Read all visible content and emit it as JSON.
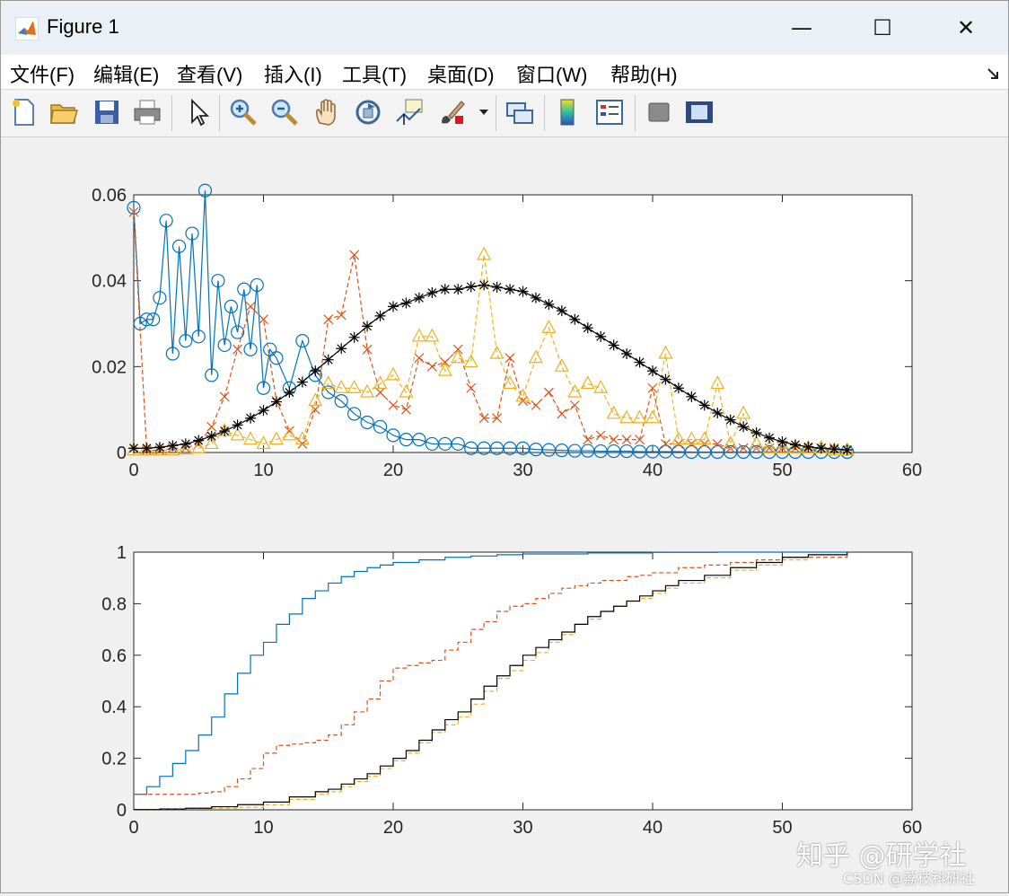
{
  "window": {
    "title": "Figure 1",
    "minimize_glyph": "—",
    "maximize_glyph": "☐",
    "close_glyph": "✕"
  },
  "menu": [
    {
      "label": "文件(F)"
    },
    {
      "label": "编辑(E)"
    },
    {
      "label": "查看(V)"
    },
    {
      "label": "插入(I)"
    },
    {
      "label": "工具(T)"
    },
    {
      "label": "桌面(D)"
    },
    {
      "label": "窗口(W)"
    },
    {
      "label": "帮助(H)"
    }
  ],
  "toolbar_icons": [
    "new-figure-icon",
    "open-file-icon",
    "save-icon",
    "print-icon",
    "select-arrow-icon",
    "zoom-in-icon",
    "zoom-out-icon",
    "pan-hand-icon",
    "rotate-3d-icon",
    "data-cursor-icon",
    "brush-icon",
    "link-plot-icon",
    "colorbar-icon",
    "legend-icon",
    "hide-plot-tools-icon",
    "show-plot-tools-icon"
  ],
  "colors": {
    "blue": "#0072bd",
    "orange": "#d95319",
    "yellow": "#edb120",
    "black": "#000000"
  },
  "watermark": {
    "line1": "知乎 @研学社",
    "line2": "CSDN @荔枝科研社"
  },
  "chart_data": [
    {
      "type": "line",
      "xlim": [
        0,
        60
      ],
      "ylim": [
        0,
        0.06
      ],
      "xticks": [
        0,
        10,
        20,
        30,
        40,
        50,
        60
      ],
      "yticks": [
        0,
        0.02,
        0.04,
        0.06
      ],
      "grid": false,
      "series": [
        {
          "color": "blue",
          "marker": "circle",
          "dash": "solid",
          "x": [
            0,
            1,
            2,
            3,
            4,
            5,
            6,
            7,
            8,
            9,
            10,
            11,
            12,
            13,
            14,
            15,
            16,
            17,
            18,
            19,
            20,
            21,
            22,
            23,
            24,
            25,
            26,
            27,
            28,
            29,
            30,
            31,
            32,
            33,
            34,
            35,
            36,
            37,
            38,
            39,
            40,
            41,
            42,
            43,
            44,
            45,
            46,
            47,
            48,
            49,
            50,
            51,
            52,
            53,
            54,
            55
          ],
          "y": [
            0.057,
            0.031,
            0.036,
            0.023,
            0.026,
            0.027,
            0.018,
            0.025,
            0.028,
            0.024,
            0.015,
            0.022,
            0.015,
            0.026,
            0.018,
            0.014,
            0.012,
            0.009,
            0.007,
            0.006,
            0.004,
            0.003,
            0.003,
            0.002,
            0.002,
            0.002,
            0.001,
            0.001,
            0.001,
            0.001,
            0.001,
            0.0007,
            0.0006,
            0.0005,
            0.0004,
            0.0004,
            0.0003,
            0.0003,
            0.0003,
            0.0002,
            0.0002,
            0.0002,
            0.0002,
            0.0001,
            0.0001,
            0.0001,
            0.0001,
            0.0001,
            0.0001,
            0.0001,
            0.0001,
            0.0001,
            0.0001,
            0.0001,
            0.0001,
            0.0001
          ],
          "x_extra": [
            1,
            2,
            3,
            4,
            5,
            6,
            7,
            8,
            9,
            10,
            11
          ],
          "y_extra": [
            0.03,
            0.031,
            0.054,
            0.048,
            0.051,
            0.061,
            0.04,
            0.034,
            0.038,
            0.039,
            0.024
          ]
        },
        {
          "color": "orange",
          "marker": "x",
          "dash": "dashed",
          "x": [
            0,
            1,
            2,
            3,
            4,
            5,
            6,
            7,
            8,
            9,
            10,
            11,
            12,
            13,
            14,
            15,
            16,
            17,
            18,
            19,
            20,
            21,
            22,
            23,
            24,
            25,
            26,
            27,
            28,
            29,
            30,
            31,
            32,
            33,
            34,
            35,
            36,
            37,
            38,
            39,
            40,
            41,
            42,
            43,
            44,
            45,
            46,
            47,
            48,
            49,
            50,
            51,
            52,
            53,
            54,
            55
          ],
          "y": [
            0.056,
            0.0005,
            0.0005,
            0.001,
            0.001,
            0.002,
            0.006,
            0.013,
            0.024,
            0.034,
            0.031,
            0.012,
            0.005,
            0.002,
            0.01,
            0.031,
            0.032,
            0.046,
            0.024,
            0.014,
            0.011,
            0.01,
            0.022,
            0.02,
            0.021,
            0.024,
            0.015,
            0.008,
            0.008,
            0.022,
            0.012,
            0.011,
            0.014,
            0.009,
            0.011,
            0.003,
            0.004,
            0.003,
            0.003,
            0.003,
            0.015,
            0.002,
            0.002,
            0.002,
            0.002,
            0.002,
            0.001,
            0.001,
            0.001,
            0.001,
            0.001,
            0.001,
            0.001,
            0.001,
            0.001,
            0.0005
          ]
        },
        {
          "color": "yellow",
          "marker": "triangle",
          "dash": "dashed",
          "x": [
            0,
            1,
            2,
            3,
            4,
            5,
            6,
            7,
            8,
            9,
            10,
            11,
            12,
            13,
            14,
            15,
            16,
            17,
            18,
            19,
            20,
            21,
            22,
            23,
            24,
            25,
            26,
            27,
            28,
            29,
            30,
            31,
            32,
            33,
            34,
            35,
            36,
            37,
            38,
            39,
            40,
            41,
            42,
            43,
            44,
            45,
            46,
            47,
            48,
            49,
            50,
            51,
            52,
            53,
            54,
            55
          ],
          "y": [
            0.0005,
            0.0005,
            0.0005,
            0.0005,
            0.0007,
            0.001,
            0.002,
            0.005,
            0.004,
            0.003,
            0.002,
            0.003,
            0.004,
            0.003,
            0.012,
            0.016,
            0.015,
            0.015,
            0.014,
            0.016,
            0.018,
            0.014,
            0.027,
            0.027,
            0.019,
            0.022,
            0.021,
            0.046,
            0.023,
            0.016,
            0.013,
            0.022,
            0.029,
            0.02,
            0.014,
            0.016,
            0.015,
            0.009,
            0.008,
            0.008,
            0.008,
            0.023,
            0.003,
            0.003,
            0.003,
            0.016,
            0.002,
            0.009,
            0.002,
            0.001,
            0.001,
            0.001,
            0.001,
            0.001,
            0.0005,
            0.0005
          ]
        },
        {
          "color": "black",
          "marker": "asterisk",
          "dash": "solid",
          "x": [
            0,
            1,
            2,
            3,
            4,
            5,
            6,
            7,
            8,
            9,
            10,
            11,
            12,
            13,
            14,
            15,
            16,
            17,
            18,
            19,
            20,
            21,
            22,
            23,
            24,
            25,
            26,
            27,
            28,
            29,
            30,
            31,
            32,
            33,
            34,
            35,
            36,
            37,
            38,
            39,
            40,
            41,
            42,
            43,
            44,
            45,
            46,
            47,
            48,
            49,
            50,
            51,
            52,
            53,
            54,
            55
          ],
          "y": [
            0.001,
            0.001,
            0.0012,
            0.0016,
            0.002,
            0.0028,
            0.0038,
            0.005,
            0.0064,
            0.008,
            0.0098,
            0.0118,
            0.014,
            0.0164,
            0.019,
            0.0216,
            0.0242,
            0.0268,
            0.0294,
            0.0318,
            0.034,
            0.0348,
            0.036,
            0.0372,
            0.038,
            0.038,
            0.0386,
            0.039,
            0.0385,
            0.038,
            0.0375,
            0.036,
            0.0345,
            0.033,
            0.031,
            0.029,
            0.027,
            0.025,
            0.023,
            0.021,
            0.019,
            0.017,
            0.015,
            0.013,
            0.011,
            0.0092,
            0.0076,
            0.006,
            0.0046,
            0.0034,
            0.0025,
            0.0018,
            0.0013,
            0.001,
            0.0008,
            0.0006
          ]
        }
      ]
    },
    {
      "type": "line",
      "step": true,
      "xlim": [
        0,
        60
      ],
      "ylim": [
        0,
        1
      ],
      "xticks": [
        0,
        10,
        20,
        30,
        40,
        50,
        60
      ],
      "yticks": [
        0,
        0.2,
        0.4,
        0.6,
        0.8,
        1
      ],
      "grid": false,
      "series": [
        {
          "color": "blue",
          "dash": "solid",
          "x": [
            0,
            1,
            2,
            3,
            4,
            5,
            6,
            7,
            8,
            9,
            10,
            11,
            12,
            13,
            14,
            15,
            16,
            17,
            18,
            19,
            20,
            22,
            24,
            26,
            28,
            30,
            35,
            40,
            45,
            50,
            55
          ],
          "y": [
            0.06,
            0.09,
            0.13,
            0.18,
            0.23,
            0.29,
            0.36,
            0.45,
            0.53,
            0.6,
            0.65,
            0.72,
            0.76,
            0.82,
            0.85,
            0.88,
            0.905,
            0.925,
            0.94,
            0.95,
            0.96,
            0.97,
            0.98,
            0.985,
            0.99,
            0.993,
            0.997,
            0.999,
            1,
            1,
            1
          ]
        },
        {
          "color": "orange",
          "dash": "dashed",
          "x": [
            0,
            1,
            2,
            3,
            4,
            5,
            6,
            7,
            8,
            9,
            10,
            11,
            12,
            13,
            14,
            15,
            16,
            17,
            18,
            19,
            20,
            21,
            22,
            23,
            24,
            25,
            26,
            27,
            28,
            29,
            30,
            31,
            32,
            33,
            34,
            35,
            36,
            37,
            38,
            39,
            40,
            42,
            44,
            46,
            48,
            50,
            55
          ],
          "y": [
            0.06,
            0.06,
            0.06,
            0.06,
            0.06,
            0.065,
            0.07,
            0.09,
            0.12,
            0.16,
            0.22,
            0.25,
            0.255,
            0.26,
            0.27,
            0.29,
            0.33,
            0.38,
            0.43,
            0.5,
            0.55,
            0.56,
            0.57,
            0.58,
            0.62,
            0.65,
            0.7,
            0.73,
            0.77,
            0.79,
            0.8,
            0.82,
            0.84,
            0.86,
            0.87,
            0.88,
            0.89,
            0.89,
            0.905,
            0.91,
            0.92,
            0.94,
            0.95,
            0.96,
            0.97,
            0.98,
            1
          ]
        },
        {
          "color": "yellow",
          "dash": "dashed",
          "x": [
            0,
            2,
            4,
            6,
            8,
            10,
            12,
            14,
            15,
            16,
            17,
            18,
            19,
            20,
            21,
            22,
            23,
            24,
            25,
            26,
            27,
            28,
            29,
            30,
            31,
            32,
            33,
            34,
            35,
            36,
            37,
            38,
            39,
            40,
            41,
            42,
            44,
            46,
            48,
            50,
            52,
            55
          ],
          "y": [
            0.001,
            0.002,
            0.003,
            0.006,
            0.01,
            0.02,
            0.04,
            0.06,
            0.07,
            0.09,
            0.11,
            0.13,
            0.16,
            0.19,
            0.22,
            0.26,
            0.3,
            0.33,
            0.36,
            0.41,
            0.46,
            0.51,
            0.54,
            0.58,
            0.61,
            0.65,
            0.68,
            0.72,
            0.74,
            0.77,
            0.79,
            0.81,
            0.82,
            0.84,
            0.86,
            0.88,
            0.9,
            0.93,
            0.95,
            0.97,
            0.99,
            1
          ]
        },
        {
          "color": "black",
          "dash": "solid",
          "x": [
            0,
            2,
            4,
            6,
            8,
            10,
            12,
            14,
            15,
            16,
            17,
            18,
            19,
            20,
            21,
            22,
            23,
            24,
            25,
            26,
            27,
            28,
            29,
            30,
            31,
            32,
            33,
            34,
            35,
            36,
            37,
            38,
            39,
            40,
            41,
            42,
            44,
            46,
            48,
            50,
            52,
            55
          ],
          "y": [
            0.001,
            0.003,
            0.006,
            0.012,
            0.02,
            0.03,
            0.05,
            0.07,
            0.08,
            0.1,
            0.12,
            0.14,
            0.17,
            0.2,
            0.23,
            0.27,
            0.31,
            0.35,
            0.38,
            0.43,
            0.48,
            0.52,
            0.56,
            0.6,
            0.63,
            0.66,
            0.69,
            0.72,
            0.75,
            0.77,
            0.79,
            0.81,
            0.83,
            0.85,
            0.87,
            0.89,
            0.91,
            0.94,
            0.96,
            0.98,
            0.99,
            1
          ]
        }
      ]
    }
  ]
}
